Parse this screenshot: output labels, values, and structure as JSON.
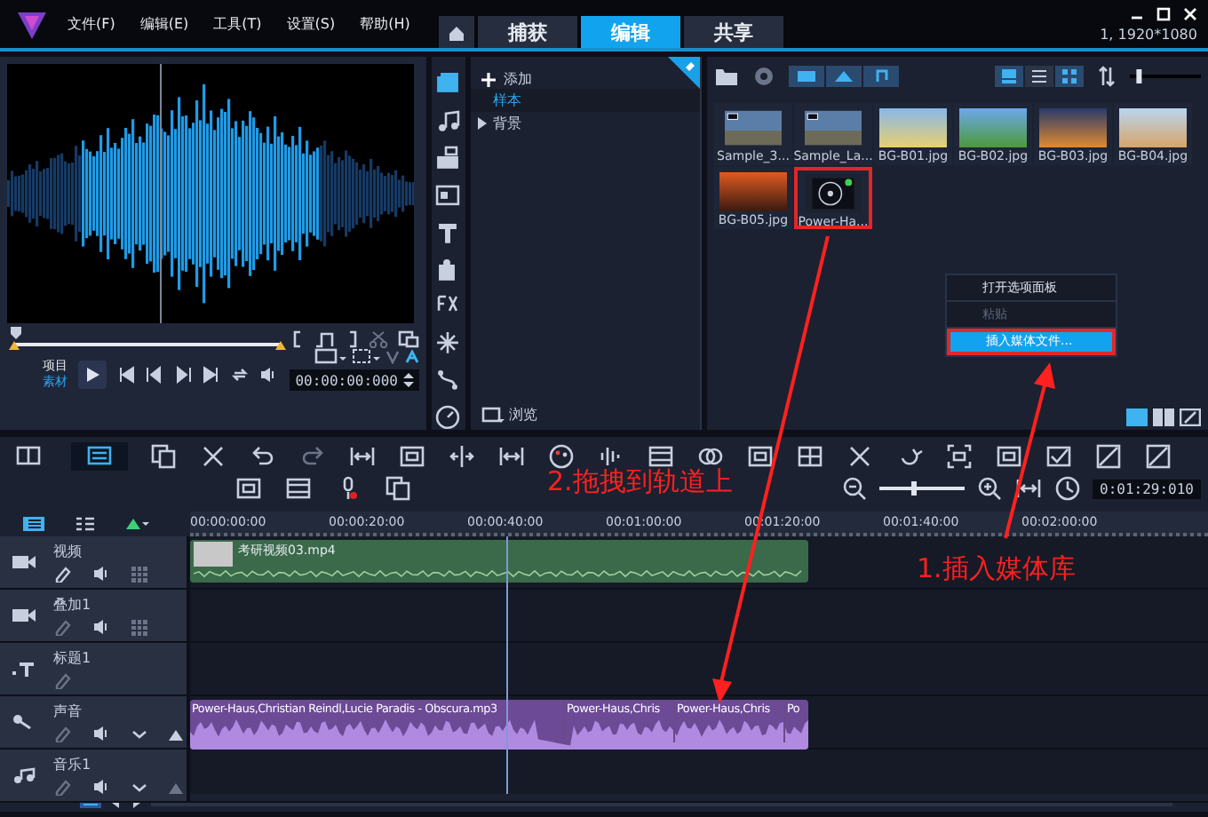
{
  "window": {
    "menus": [
      "文件(F)",
      "编辑(E)",
      "工具(T)",
      "设置(S)",
      "帮助(H)"
    ],
    "tabs": [
      {
        "label": "捕获",
        "selected": false
      },
      {
        "label": "编辑",
        "selected": true
      },
      {
        "label": "共享",
        "selected": false
      }
    ],
    "status": "1, 1920*1080"
  },
  "player": {
    "scrubber": {
      "level": 0
    },
    "modes": [
      {
        "label": "项目",
        "selected": false
      },
      {
        "label": "素材",
        "selected": true
      }
    ],
    "timecode": "00:00:00:000"
  },
  "library": {
    "thumbnail_size": {
      "level": 0.1
    },
    "add_label": "添加",
    "browse_label": "浏览",
    "folders": [
      {
        "label": "样本",
        "selected": true,
        "expandable": false
      },
      {
        "label": "背景",
        "selected": false,
        "expandable": true
      }
    ],
    "media": [
      {
        "name": "Sample_3...",
        "kind": "video",
        "selected": false
      },
      {
        "name": "Sample_La...",
        "kind": "video",
        "selected": false
      },
      {
        "name": "BG-B01.jpg",
        "kind": "photo",
        "selected": false
      },
      {
        "name": "BG-B02.jpg",
        "kind": "photo",
        "selected": false
      },
      {
        "name": "BG-B03.jpg",
        "kind": "photo",
        "selected": false
      },
      {
        "name": "BG-B04.jpg",
        "kind": "photo",
        "selected": false
      },
      {
        "name": "BG-B05.jpg",
        "kind": "photo",
        "selected": false
      },
      {
        "name": "Power-Ha...",
        "kind": "audio",
        "selected": true
      }
    ],
    "context_menu": [
      {
        "label": "打开选项面板",
        "disabled": false,
        "selected": false
      },
      {
        "label": "粘贴",
        "disabled": true,
        "selected": false
      },
      {
        "label": "插入媒体文件...",
        "disabled": false,
        "selected": true
      }
    ]
  },
  "timeline": {
    "zoom": {
      "level": 0.4
    },
    "view_buttons": [
      {
        "selected": false
      },
      {
        "selected": true
      }
    ],
    "timecode": "0:01:29:010",
    "ruler": [
      "00:00:00:00",
      "00:00:20:00",
      "00:00:40:00",
      "00:01:00:00",
      "00:01:20:00",
      "00:01:40:00",
      "00:02:00:00"
    ],
    "tracks": [
      {
        "name": "视频",
        "kind": "video",
        "clips": [
          "考研视频03.mp4"
        ]
      },
      {
        "name": "叠加1",
        "kind": "overlay"
      },
      {
        "name": "标题1",
        "kind": "title"
      },
      {
        "name": "声音",
        "kind": "voice",
        "clips": [
          "Power-Haus,Christian Reindl,Lucie Paradis - Obscura.mp3",
          "Power-Haus,Chris",
          "Power-Haus,Chris",
          "Po"
        ]
      },
      {
        "name": "音乐1",
        "kind": "music"
      }
    ]
  },
  "annotations": [
    {
      "text": "2.拖拽到轨道上"
    },
    {
      "text": "1.插入媒体库"
    }
  ]
}
